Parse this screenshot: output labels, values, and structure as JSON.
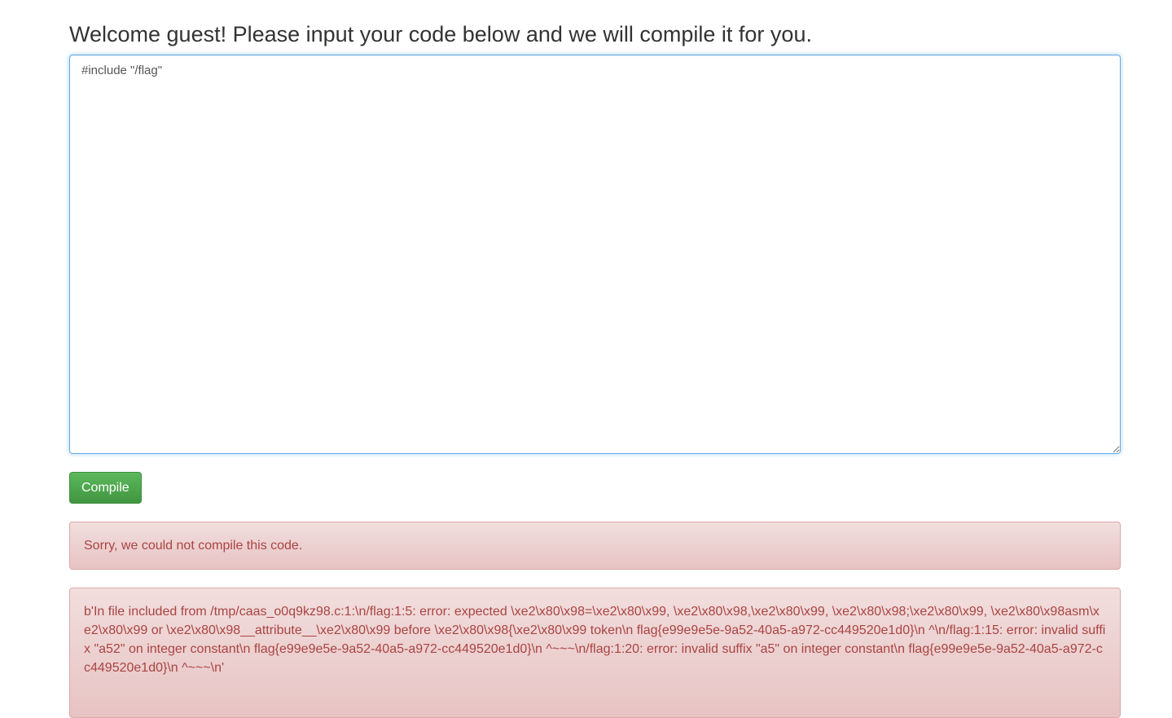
{
  "page": {
    "title": "Welcome guest! Please input your code below and we will compile it for you."
  },
  "editor": {
    "value": "#include \"/flag\""
  },
  "compile_button": {
    "label": "Compile",
    "color": "#5cb85c"
  },
  "alerts": {
    "sorry_message": "Sorry, we could not compile this code.",
    "compiler_output": "b'In file included from /tmp/caas_o0q9kz98.c:1:\\n/flag:1:5: error: expected \\xe2\\x80\\x98=\\xe2\\x80\\x99, \\xe2\\x80\\x98,\\xe2\\x80\\x99, \\xe2\\x80\\x98;\\xe2\\x80\\x99, \\xe2\\x80\\x98asm\\xe2\\x80\\x99 or \\xe2\\x80\\x98__attribute__\\xe2\\x80\\x99 before \\xe2\\x80\\x98{\\xe2\\x80\\x99 token\\n flag{e99e9e5e-9a52-40a5-a972-cc449520e1d0}\\n ^\\n/flag:1:15: error: invalid suffix \"a52\" on integer constant\\n flag{e99e9e5e-9a52-40a5-a972-cc449520e1d0}\\n ^~~~\\n/flag:1:20: error: invalid suffix \"a5\" on integer constant\\n flag{e99e9e5e-9a52-40a5-a972-cc449520e1d0}\\n ^~~~\\n'",
    "error_color": "#a94442"
  }
}
